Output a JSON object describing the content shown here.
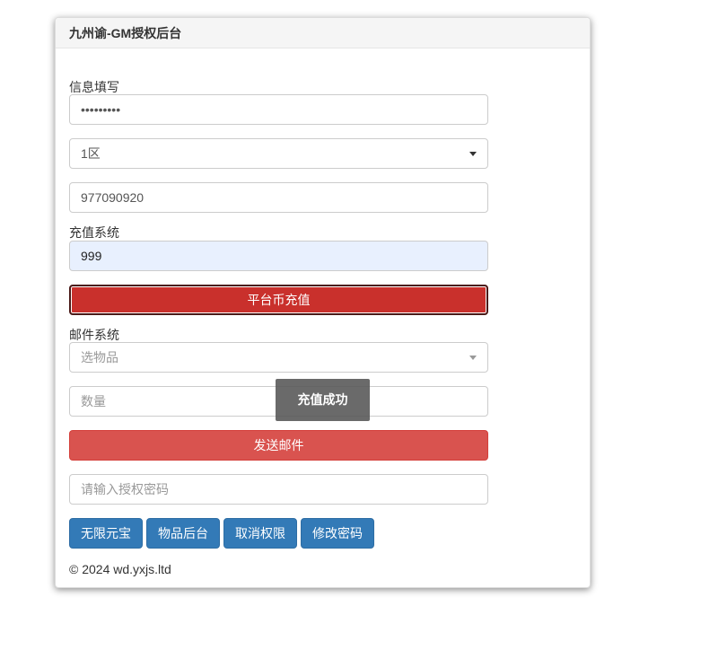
{
  "panel": {
    "title": "九州谕-GM授权后台"
  },
  "info": {
    "label": "信息填写",
    "password_value": "•••••••••",
    "zone_selected": "1区",
    "account_value": "977090920"
  },
  "recharge": {
    "label": "充值系统",
    "amount_value": "999",
    "button_label": "平台币充值"
  },
  "mail": {
    "label": "邮件系统",
    "item_placeholder": "选物品",
    "quantity_placeholder": "数量",
    "send_button_label": "发送邮件"
  },
  "auth": {
    "password_placeholder": "请输入授权密码"
  },
  "actions": {
    "unlimited_yuanbao": "无限元宝",
    "item_backend": "物品后台",
    "revoke_permission": "取消权限",
    "change_password": "修改密码"
  },
  "footer": {
    "copyright": "© 2024 wd.yxjs.ltd"
  },
  "toast": {
    "message": "充值成功"
  },
  "colors": {
    "danger": "#d9534f",
    "danger_active": "#c9302c",
    "primary": "#337ab7",
    "autofill_bg": "#e8f0fe"
  }
}
